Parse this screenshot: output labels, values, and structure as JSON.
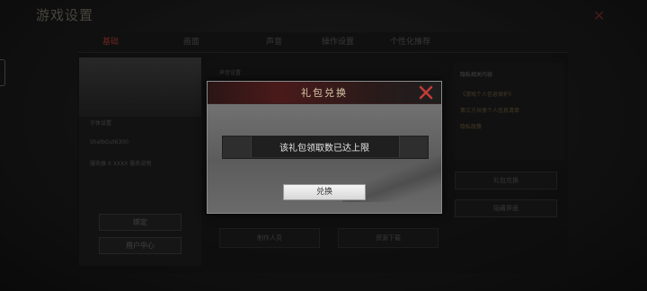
{
  "screen": {
    "title": "游戏设置",
    "tabs": [
      "基础",
      "画面",
      "声音",
      "操作设置",
      "个性化推荐"
    ],
    "side_info": [
      "字体设置",
      "ShelbOut6300",
      "服务器 X XXXX 服务说明"
    ],
    "left_buttons": [
      "绑定",
      "用户中心"
    ],
    "right_header": "隐私相关内容",
    "right_links": [
      "《游戏个人信息保护》",
      "第三方共享个人信息清单",
      "隐私政策"
    ],
    "right_buttons": [
      "礼包兑换",
      "隐藏界面"
    ],
    "bottom_buttons": [
      "制作人员",
      "资源下载"
    ],
    "sound_label": "声音设置"
  },
  "dialog": {
    "title": "礼包兑换",
    "message": "该礼包领取数已达上限",
    "confirm_label": "兑换"
  },
  "colors": {
    "accent": "#a23a2c",
    "close": "#c23a3a",
    "title": "#d8c9a8"
  }
}
